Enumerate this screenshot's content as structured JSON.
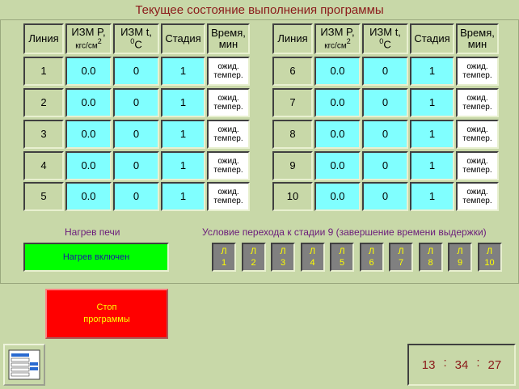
{
  "title": "Текущее состояние выполнения программы",
  "headers": {
    "line": "Линия",
    "pressure_main": "ИЗМ P,",
    "pressure_unit": "кгс/см",
    "pressure_exp": "2",
    "temp_main": "ИЗМ t,",
    "temp_exp": "0",
    "temp_unit": "С",
    "stage": "Стадия",
    "time_main": "Время,",
    "time_unit": "мин"
  },
  "rows": [
    {
      "line": "1",
      "pressure": "0.0",
      "temp": "0",
      "stage": "1",
      "time": "ожид. темпер."
    },
    {
      "line": "2",
      "pressure": "0.0",
      "temp": "0",
      "stage": "1",
      "time": "ожид. темпер."
    },
    {
      "line": "3",
      "pressure": "0.0",
      "temp": "0",
      "stage": "1",
      "time": "ожид. темпер."
    },
    {
      "line": "4",
      "pressure": "0.0",
      "temp": "0",
      "stage": "1",
      "time": "ожид. темпер."
    },
    {
      "line": "5",
      "pressure": "0.0",
      "temp": "0",
      "stage": "1",
      "time": "ожид. темпер."
    },
    {
      "line": "6",
      "pressure": "0.0",
      "temp": "0",
      "stage": "1",
      "time": "ожид. темпер."
    },
    {
      "line": "7",
      "pressure": "0.0",
      "temp": "0",
      "stage": "1",
      "time": "ожид. темпер."
    },
    {
      "line": "8",
      "pressure": "0.0",
      "temp": "0",
      "stage": "1",
      "time": "ожид. темпер."
    },
    {
      "line": "9",
      "pressure": "0.0",
      "temp": "0",
      "stage": "1",
      "time": "ожид. темпер."
    },
    {
      "line": "10",
      "pressure": "0.0",
      "temp": "0",
      "stage": "1",
      "time": "ожид. темпер."
    }
  ],
  "heating": {
    "label": "Нагрев печи",
    "status": "Нагрев включен",
    "status_color": "#00ff00"
  },
  "condition": {
    "label": "Условие перехода к стадии 9 (завершение времени выдержки)",
    "lamp_prefix": "Л",
    "lamps": [
      "1",
      "2",
      "3",
      "4",
      "5",
      "6",
      "7",
      "8",
      "9",
      "10"
    ]
  },
  "stop_button": {
    "line1": "Стоп",
    "line2": "программы",
    "color": "#ff0000"
  },
  "menu_button": {
    "icon": "menu-list-icon"
  },
  "clock": {
    "hours": "13",
    "minutes": "34",
    "seconds": "27",
    "separator": ":"
  }
}
